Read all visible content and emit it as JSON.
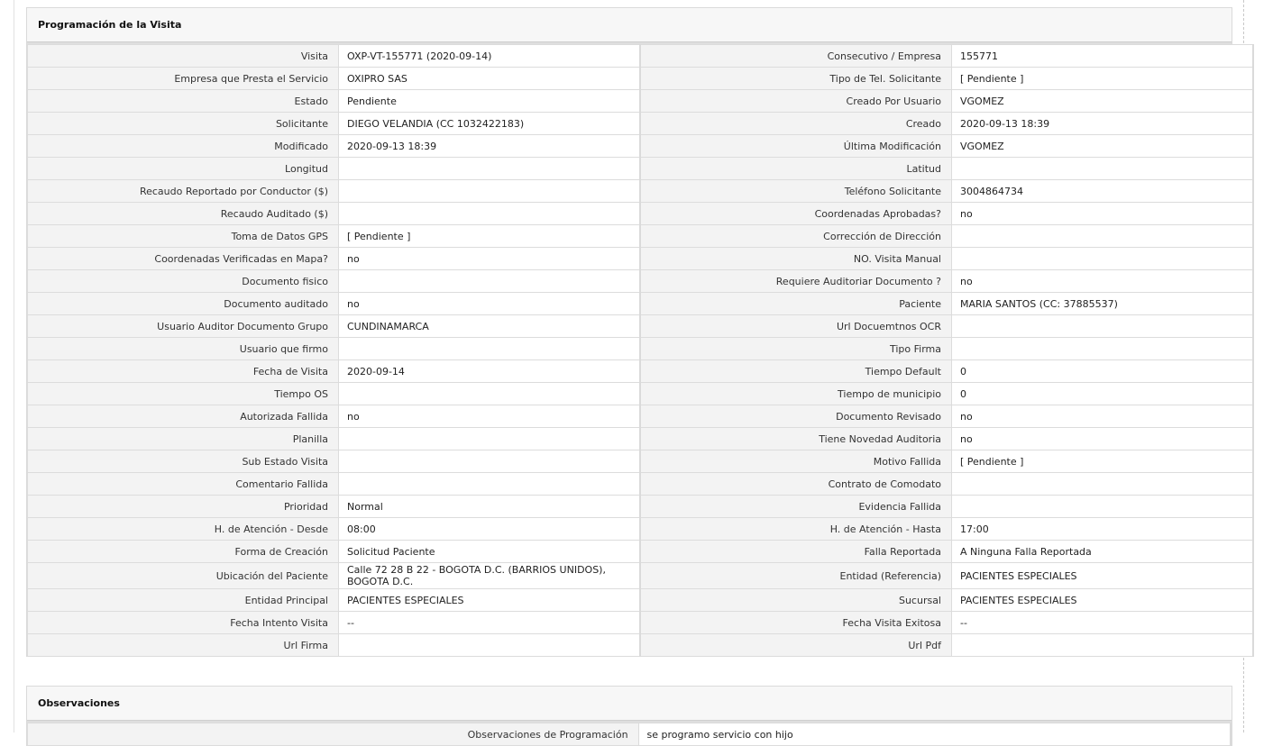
{
  "programacion": {
    "title": "Programación de la Visita",
    "rows": [
      {
        "l1": "Visita",
        "v1": "OXP-VT-155771 (2020-09-14)",
        "l2": "Consecutivo / Empresa",
        "v2": "155771"
      },
      {
        "l1": "Empresa que Presta el Servicio",
        "v1": "OXIPRO SAS",
        "l2": "Tipo de Tel. Solicitante",
        "v2": "[ Pendiente ]"
      },
      {
        "l1": "Estado",
        "v1": "Pendiente",
        "l2": "Creado Por Usuario",
        "v2": "VGOMEZ"
      },
      {
        "l1": "Solicitante",
        "v1": "DIEGO VELANDIA (CC 1032422183)",
        "l2": "Creado",
        "v2": "2020-09-13 18:39"
      },
      {
        "l1": "Modificado",
        "v1": "2020-09-13 18:39",
        "l2": "Última Modificación",
        "v2": " VGOMEZ"
      },
      {
        "l1": "Longitud",
        "v1": "",
        "l2": "Latitud",
        "v2": ""
      },
      {
        "l1": "Recaudo Reportado por Conductor ($)",
        "v1": "",
        "l2": "Teléfono Solicitante",
        "v2": "3004864734"
      },
      {
        "l1": "Recaudo Auditado ($)",
        "v1": "",
        "l2": "Coordenadas Aprobadas?",
        "v2": " no"
      },
      {
        "l1": "Toma de Datos GPS",
        "v1": "[ Pendiente ]",
        "l2": "Corrección de Dirección",
        "v2": ""
      },
      {
        "l1": "Coordenadas Verificadas en Mapa?",
        "v1": " no",
        "l2": "NO. Visita Manual",
        "v2": ""
      },
      {
        "l1": "Documento fisico",
        "v1": "",
        "l2": "Requiere Auditoriar Documento ?",
        "v2": " no"
      },
      {
        "l1": "Documento auditado",
        "v1": " no",
        "l2": "Paciente",
        "v2": "MARIA SANTOS (CC: 37885537)"
      },
      {
        "l1": "Usuario Auditor Documento Grupo",
        "v1": "CUNDINAMARCA",
        "l2": "Url Docuemtnos OCR",
        "v2": ""
      },
      {
        "l1": "Usuario que firmo",
        "v1": "",
        "l2": "Tipo Firma",
        "v2": ""
      },
      {
        "l1": "Fecha de Visita",
        "v1": " 2020-09-14",
        "l2": "Tiempo Default",
        "v2": "0"
      },
      {
        "l1": "Tiempo OS",
        "v1": "",
        "l2": "Tiempo de municipio",
        "v2": "0"
      },
      {
        "l1": "Autorizada Fallida",
        "v1": " no",
        "l2": "Documento Revisado",
        "v2": " no"
      },
      {
        "l1": "Planilla",
        "v1": "",
        "l2": "Tiene Novedad Auditoria",
        "v2": " no"
      },
      {
        "l1": "Sub Estado Visita",
        "v1": "",
        "l2": "Motivo Fallida",
        "v2": "[ Pendiente ]"
      },
      {
        "l1": "Comentario Fallida",
        "v1": "",
        "l2": "Contrato de Comodato",
        "v2": ""
      },
      {
        "l1": "Prioridad",
        "v1": "Normal",
        "l2": "Evidencia Fallida",
        "v2": ""
      },
      {
        "l1": "H. de Atención - Desde",
        "v1": "08:00",
        "l2": "H. de Atención - Hasta",
        "v2": "17:00"
      },
      {
        "l1": "Forma de Creación",
        "v1": "Solicitud Paciente",
        "l2": "Falla Reportada",
        "v2": "A Ninguna Falla Reportada"
      },
      {
        "l1": "Ubicación del Paciente",
        "v1": "Calle 72 28 B 22 - BOGOTA D.C. (BARRIOS UNIDOS), BOGOTA D.C.",
        "l2": "Entidad (Referencia)",
        "v2": "PACIENTES ESPECIALES"
      },
      {
        "l1": "Entidad Principal",
        "v1": "PACIENTES ESPECIALES",
        "l2": "Sucursal",
        "v2": "PACIENTES ESPECIALES"
      },
      {
        "l1": "Fecha Intento Visita",
        "v1": " --",
        "l2": "Fecha Visita Exitosa",
        "v2": " --"
      },
      {
        "l1": "Url Firma",
        "v1": "",
        "l2": "Url Pdf",
        "v2": ""
      }
    ]
  },
  "observaciones": {
    "title": "Observaciones",
    "rows": [
      {
        "l1": "Observaciones de Programación",
        "v1": " se programo servicio con hijo"
      }
    ]
  }
}
